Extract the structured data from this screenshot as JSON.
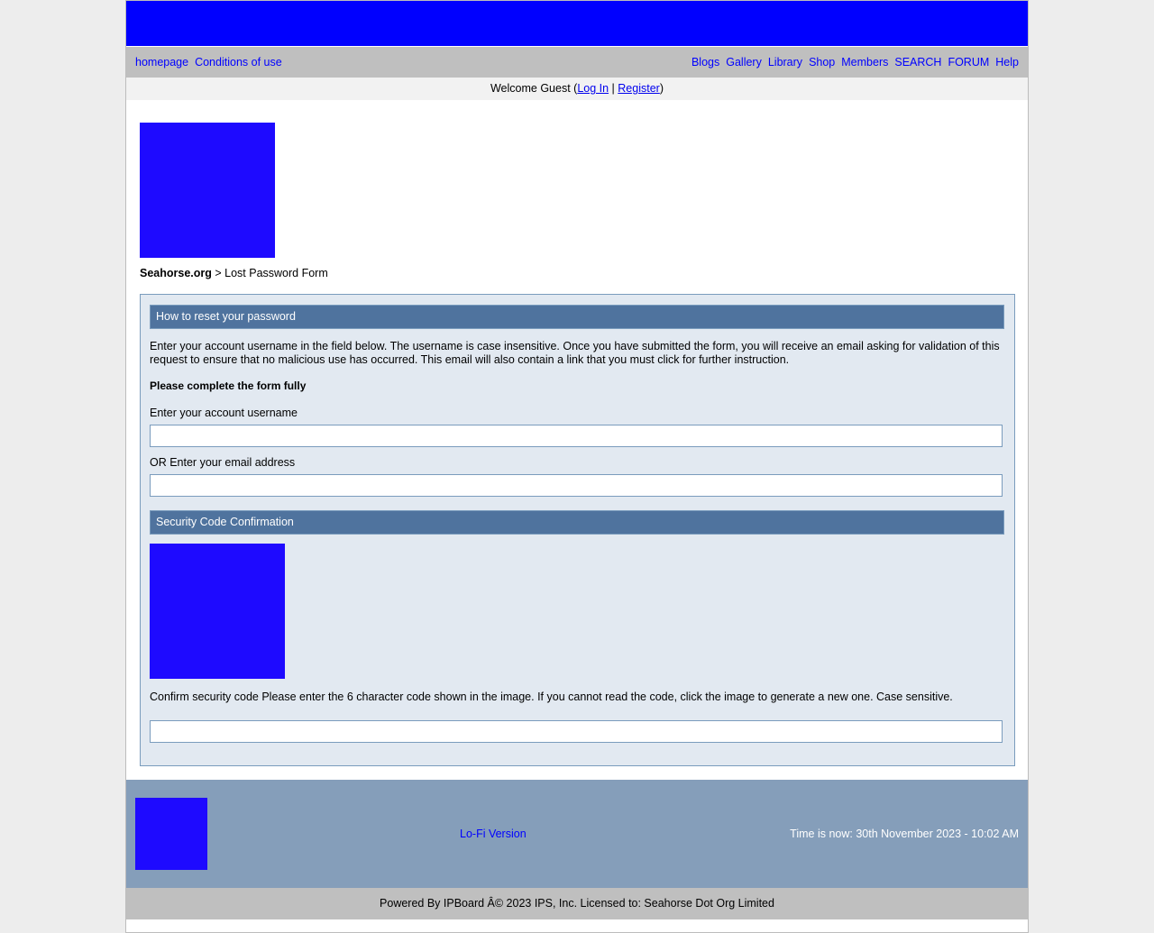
{
  "banner": {},
  "nav": {
    "left": [
      "homepage",
      "Conditions of use"
    ],
    "right": [
      "Blogs",
      "Gallery",
      "Library",
      "Shop",
      "Members",
      "SEARCH",
      "FORUM",
      "Help"
    ]
  },
  "welcome": {
    "prefix": "Welcome Guest (",
    "login": "Log In",
    "separator": " | ",
    "register": "Register",
    "suffix": ")"
  },
  "breadcrumb": {
    "site": "Seahorse.org",
    "separator": " > ",
    "current": "Lost Password Form"
  },
  "form": {
    "reset_header": "How to reset your password",
    "instructions": "Enter your account username in the field below. The username is case insensitive. Once you have submitted the form, you will receive an email asking for validation of this request to ensure that no malicious use has occurred. This email will also contain a link that you must click for further instruction.",
    "notice": "Please complete the form fully",
    "username_label": "Enter your account username",
    "username_value": "",
    "email_label": "OR Enter your email address",
    "email_value": "",
    "security_header": "Security Code Confirmation",
    "captcha_text": "Confirm security code Please enter the 6 character code shown in the image. If you cannot read the code, click the image to generate a new one. Case sensitive.",
    "captcha_value": ""
  },
  "footer": {
    "lofi": "Lo-Fi Version",
    "time": "Time is now: 30th November 2023 - 10:02 AM",
    "copyright": "Powered By IPBoard Â© 2023 IPS, Inc. Licensed to: Seahorse Dot Org Limited"
  },
  "colors": {
    "banner": "#0000ff",
    "nav_bg": "#bfbfbf",
    "link": "#0000ff",
    "form_bg": "#e2e9f1",
    "section_header": "#4f739e",
    "footer_bg": "#859eba",
    "image_placeholder": "#1e0aff"
  }
}
